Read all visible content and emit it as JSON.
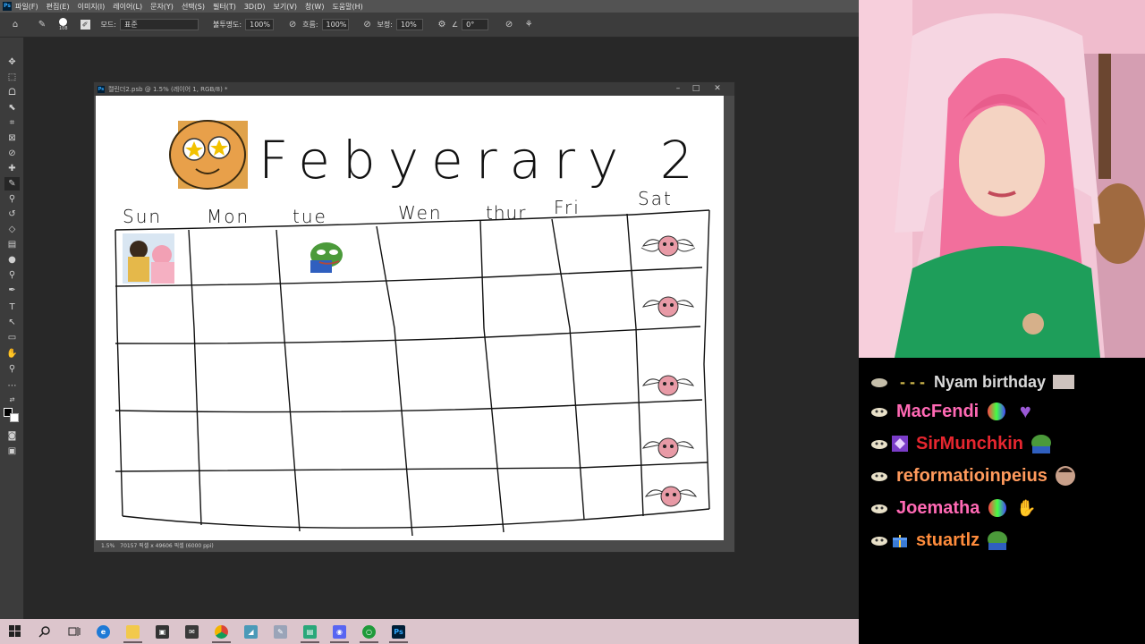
{
  "menubar": {
    "logo": "Ps",
    "items": [
      "파일(F)",
      "편집(E)",
      "이미지(I)",
      "레이어(L)",
      "문자(Y)",
      "선택(S)",
      "필터(T)",
      "3D(D)",
      "보기(V)",
      "창(W)",
      "도움말(H)"
    ]
  },
  "options": {
    "brush_size": "108",
    "mode_label": "모드:",
    "mode_value": "표준",
    "opacity_label": "불투명도:",
    "opacity_value": "100%",
    "flow_label": "흐름:",
    "flow_value": "100%",
    "smoothing_label": "보정:",
    "smoothing_value": "10%",
    "angle_value": "0°"
  },
  "document": {
    "title": "캘린더2.psb @ 1.5% (레이어 1, RGB/8) *",
    "status_zoom": "1.5%",
    "status_size": "70157 픽셀 x 49606 픽셀 (6000 ppi)",
    "canvas": {
      "heading": "Febyerary 2",
      "days": [
        "Sun",
        "Mon",
        "tue",
        "Wen",
        "thur",
        "Fri",
        "Sat"
      ]
    }
  },
  "taskbar": {
    "apps": [
      "start",
      "search",
      "task-view",
      "edge",
      "file-explorer",
      "store",
      "mail",
      "chrome",
      "app-1",
      "app-2",
      "app-3",
      "discord",
      "app-4",
      "photoshop"
    ]
  },
  "chat": {
    "partial_message": "Nyam birthday",
    "messages": [
      {
        "user": "MacFendi",
        "color": "#ff69b4",
        "emotes": [
          "rainbow-emote",
          "purple-heart-emote"
        ]
      },
      {
        "user": "SirMunchkin",
        "color": "#e6262f",
        "emotes": [
          "pepe-emote"
        ],
        "sub_badge": true
      },
      {
        "user": "reformatioinpeius",
        "color": "#ff9a5c",
        "emotes": [
          "face-emote"
        ]
      },
      {
        "user": "Joematha",
        "color": "#ff69b4",
        "emotes": [
          "rainbow-emote",
          "hands-emote"
        ]
      },
      {
        "user": "stuartlz",
        "color": "#ff8c3c",
        "emotes": [
          "pepe-emote"
        ],
        "gift_badge": true
      }
    ]
  },
  "colors": {
    "ps_bg": "#282828",
    "ps_panel": "#3c3c3c",
    "taskbar": "#dcc5cc",
    "chat_bg": "#000000"
  }
}
